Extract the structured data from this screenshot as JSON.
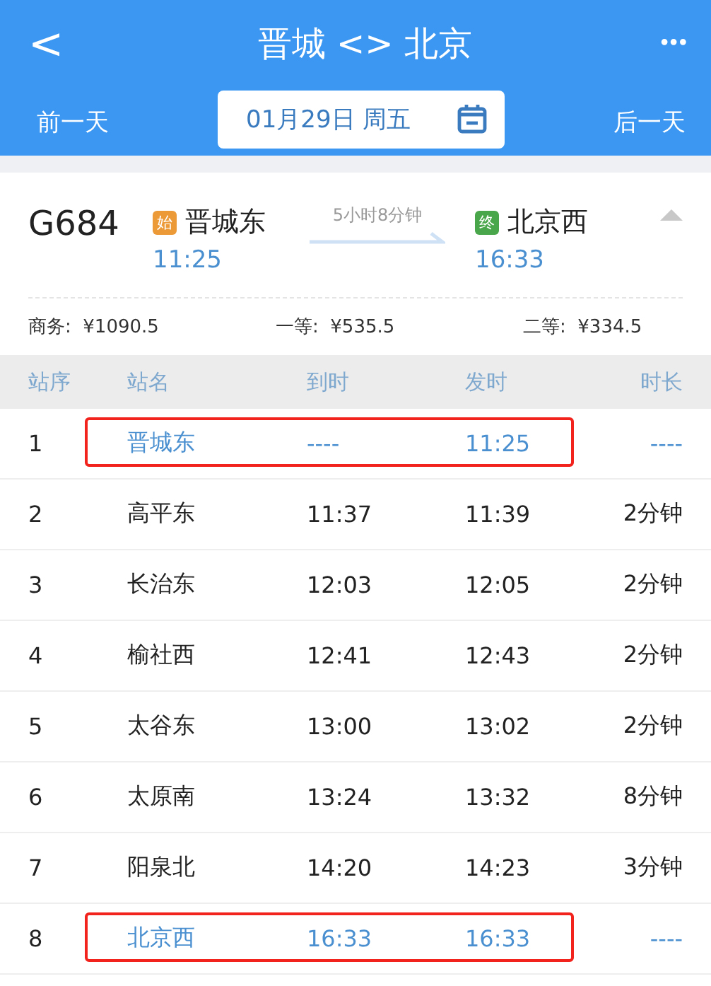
{
  "nav": {
    "back": "<",
    "title": "晋城 <> 北京",
    "more": "•••"
  },
  "date_bar": {
    "prev": "前一天",
    "date": "01月29日 周五",
    "next": "后一天"
  },
  "train": {
    "number": "G684",
    "from_badge": "始",
    "from": "晋城东",
    "from_time": "11:25",
    "duration": "5小时8分钟",
    "to_badge": "终",
    "to": "北京西",
    "to_time": "16:33",
    "expanded": true
  },
  "prices": [
    {
      "label": "商务:",
      "value": "¥1090.5"
    },
    {
      "label": "一等:",
      "value": "¥535.5"
    },
    {
      "label": "二等:",
      "value": "¥334.5"
    }
  ],
  "table": {
    "columns": [
      "站序",
      "站名",
      "到时",
      "发时",
      "时长"
    ],
    "rows": [
      {
        "cells": [
          "1",
          "晋城东",
          "----",
          "11:25",
          "----"
        ],
        "highlighted": true
      },
      {
        "cells": [
          "2",
          "高平东",
          "11:37",
          "11:39",
          "2分钟"
        ],
        "highlighted": false
      },
      {
        "cells": [
          "3",
          "长治东",
          "12:03",
          "12:05",
          "2分钟"
        ],
        "highlighted": false
      },
      {
        "cells": [
          "4",
          "榆社西",
          "12:41",
          "12:43",
          "2分钟"
        ],
        "highlighted": false
      },
      {
        "cells": [
          "5",
          "太谷东",
          "13:00",
          "13:02",
          "2分钟"
        ],
        "highlighted": false
      },
      {
        "cells": [
          "6",
          "太原南",
          "13:24",
          "13:32",
          "8分钟"
        ],
        "highlighted": false
      },
      {
        "cells": [
          "7",
          "阳泉北",
          "14:20",
          "14:23",
          "3分钟"
        ],
        "highlighted": false
      },
      {
        "cells": [
          "8",
          "北京西",
          "16:33",
          "16:33",
          "----"
        ],
        "highlighted": true
      }
    ]
  }
}
